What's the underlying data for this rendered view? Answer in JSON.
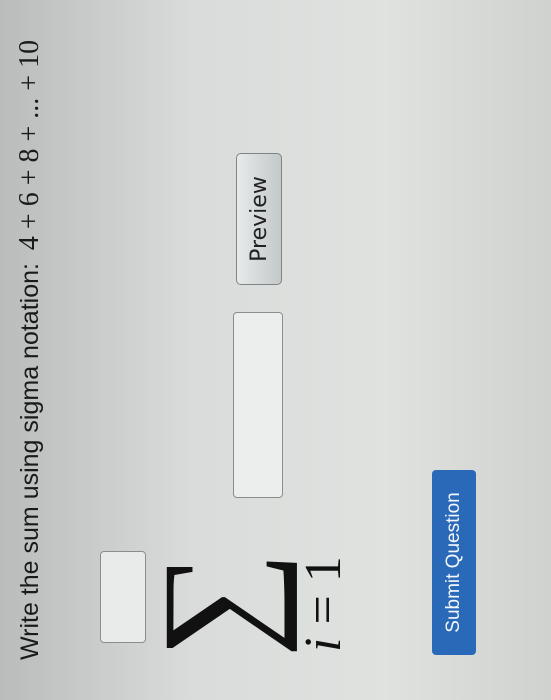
{
  "question": {
    "prompt": "Write the sum using sigma notation:",
    "expression": "4 + 6 + 8 + ... + 10"
  },
  "sigma_notation": {
    "symbol": "∑",
    "index_variable": "i",
    "index_equals": "=",
    "lower_limit": "1",
    "upper_limit_value": "",
    "term_value": ""
  },
  "buttons": {
    "preview_label": "Preview",
    "submit_label": "Submit Question"
  },
  "colors": {
    "submit_button": "#2a69b8"
  }
}
